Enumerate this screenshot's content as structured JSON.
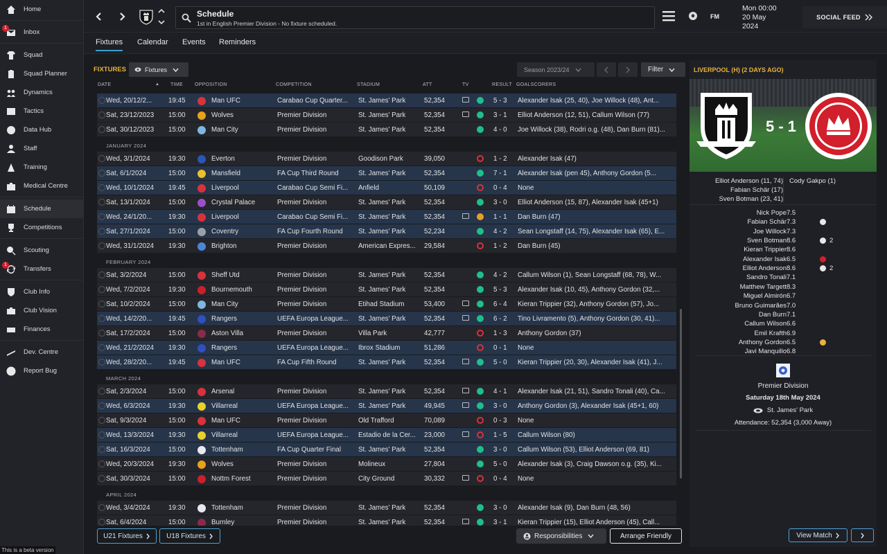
{
  "sidebar": {
    "items": [
      {
        "label": "Home",
        "icon": "home-icon"
      },
      {
        "label": "Inbox",
        "icon": "inbox-icon",
        "badge": "1"
      },
      {
        "label": "Squad",
        "icon": "shirt-icon"
      },
      {
        "label": "Squad Planner",
        "icon": "clipboard-icon"
      },
      {
        "label": "Dynamics",
        "icon": "dynamics-icon"
      },
      {
        "label": "Tactics",
        "icon": "tactics-board-icon"
      },
      {
        "label": "Data Hub",
        "icon": "data-hub-icon"
      },
      {
        "label": "Staff",
        "icon": "staff-icon"
      },
      {
        "label": "Training",
        "icon": "training-cone-icon"
      },
      {
        "label": "Medical Centre",
        "icon": "medical-kit-icon"
      },
      {
        "label": "Schedule",
        "icon": "calendar-icon"
      },
      {
        "label": "Competitions",
        "icon": "trophy-icon"
      },
      {
        "label": "Scouting",
        "icon": "magnifier-icon"
      },
      {
        "label": "Transfers",
        "icon": "transfers-icon",
        "badge": "1"
      },
      {
        "label": "Club Info",
        "icon": "shield-icon"
      },
      {
        "label": "Club Vision",
        "icon": "briefcase-icon"
      },
      {
        "label": "Finances",
        "icon": "cash-icon"
      },
      {
        "label": "Dev. Centre",
        "icon": "development-icon"
      },
      {
        "label": "Report Bug",
        "icon": "alert-icon"
      }
    ],
    "beta": "This is a beta version"
  },
  "header": {
    "title": "Schedule",
    "subtitle": "1st in English Premier Division - No fixture scheduled.",
    "fm": "FM",
    "date_line1": "Mon 00:00",
    "date_line2": "20 May",
    "date_line3": "2024",
    "social_feed": "SOCIAL FEED"
  },
  "tabs": [
    "Fixtures",
    "Calendar",
    "Events",
    "Reminders"
  ],
  "main": {
    "title": "FIXTURES",
    "view_dd": "Fixtures",
    "season": "Season 2023/24",
    "filter": "Filter",
    "columns": {
      "date": "DATE",
      "time": "TIME",
      "opposition": "OPPOSITION",
      "competition": "COMPETITION",
      "stadium": "STADIUM",
      "att": "ATT",
      "tv": "TV",
      "result": "RESULT",
      "goalscorers": "GOALSCORERS"
    },
    "footer": {
      "u21": "U21 Fixtures",
      "u18": "U18 Fixtures",
      "responsibilities": "Responsibilities",
      "arrange": "Arrange Friendly"
    }
  },
  "fixtures": [
    {
      "date": "Wed, 20/12/2...",
      "time": "19:45",
      "opp": "Man UFC",
      "comp": "Carabao Cup Quarter...",
      "stadium": "St. James' Park",
      "att": "52,354",
      "tv": true,
      "res": "W",
      "score": "5 - 3",
      "scorers": "Alexander Isak (25, 40), Joe Willock (48), Ant...",
      "hl": true,
      "crest": "#d8323c"
    },
    {
      "date": "Sat, 23/12/2023",
      "time": "15:00",
      "opp": "Wolves",
      "comp": "Premier Division",
      "stadium": "St. James' Park",
      "att": "52,354",
      "tv": true,
      "res": "W",
      "score": "3 - 1",
      "scorers": "Elliot Anderson (12, 51), Callum Wilson (77)",
      "crest": "#e8a11c"
    },
    {
      "date": "Sat, 30/12/2023",
      "time": "15:00",
      "opp": "Man City",
      "comp": "Premier Division",
      "stadium": "St. James' Park",
      "att": "52,354",
      "tv": false,
      "res": "W",
      "score": "4 - 0",
      "scorers": "Joe Willock (38), Rodri o.g. (48), Dan Burn (81)...",
      "crest": "#7fb6e0"
    },
    {
      "month": "JANUARY 2024"
    },
    {
      "date": "Wed, 3/1/2024",
      "time": "19:30",
      "opp": "Everton",
      "comp": "Premier Division",
      "stadium": "Goodison Park",
      "att": "39,050",
      "tv": false,
      "res": "L",
      "score": "1 - 2",
      "scorers": "Alexander Isak (47)",
      "crest": "#2a56b8"
    },
    {
      "date": "Sat, 6/1/2024",
      "time": "15:00",
      "opp": "Mansfield",
      "comp": "FA Cup Third Round",
      "stadium": "St. James' Park",
      "att": "52,354",
      "tv": false,
      "res": "W",
      "score": "7 - 1",
      "scorers": "Alexander Isak (pen 45), Anthony Gordon (5...",
      "hl": true,
      "crest": "#e8c12c"
    },
    {
      "date": "Wed, 10/1/2024",
      "time": "19:45",
      "opp": "Liverpool",
      "comp": "Carabao Cup Semi Fi...",
      "stadium": "Anfield",
      "att": "50,109",
      "tv": false,
      "res": "L",
      "score": "0 - 4",
      "scorers": "None",
      "hl": true,
      "crest": "#d8323c"
    },
    {
      "date": "Sat, 13/1/2024",
      "time": "15:00",
      "opp": "Crystal Palace",
      "comp": "Premier Division",
      "stadium": "St. James' Park",
      "att": "52,354",
      "tv": false,
      "res": "W",
      "score": "3 - 0",
      "scorers": "Elliot Anderson (15, 87), Alexander Isak (45+1)",
      "crest": "#9b4fc8"
    },
    {
      "date": "Wed, 24/1/20...",
      "time": "19:30",
      "opp": "Liverpool",
      "comp": "Carabao Cup Semi Fi...",
      "stadium": "St. James' Park",
      "att": "52,354",
      "tv": true,
      "res": "D",
      "score": "1 - 1",
      "scorers": "Dan Burn (47)",
      "hl": true,
      "crest": "#d8323c"
    },
    {
      "date": "Sat, 27/1/2024",
      "time": "15:00",
      "opp": "Coventry",
      "comp": "FA Cup Fourth Round",
      "stadium": "St. James' Park",
      "att": "52,234",
      "tv": false,
      "res": "W",
      "score": "4 - 2",
      "scorers": "Sean Longstaff (14, 75), Alexander Isak (65), E...",
      "hl": true,
      "crest": "#9aa0a8"
    },
    {
      "date": "Wed, 31/1/2024",
      "time": "19:30",
      "opp": "Brighton",
      "comp": "Premier Division",
      "stadium": "American Expres...",
      "att": "29,584",
      "tv": false,
      "res": "L",
      "score": "1 - 2",
      "scorers": "Dan Burn (45)",
      "crest": "#4b86d6"
    },
    {
      "month": "FEBRUARY 2024"
    },
    {
      "date": "Sat, 3/2/2024",
      "time": "15:00",
      "opp": "Sheff Utd",
      "comp": "Premier Division",
      "stadium": "St. James' Park",
      "att": "52,354",
      "tv": false,
      "res": "W",
      "score": "4 - 2",
      "scorers": "Callum Wilson (1), Sean Longstaff (68, 78), W...",
      "crest": "#d8323c"
    },
    {
      "date": "Wed, 7/2/2024",
      "time": "19:30",
      "opp": "Bournemouth",
      "comp": "Premier Division",
      "stadium": "St. James' Park",
      "att": "52,354",
      "tv": false,
      "res": "W",
      "score": "5 - 3",
      "scorers": "Alexander Isak (10, 45), Anthony Gordon (32,...",
      "crest": "#c8202c"
    },
    {
      "date": "Sat, 10/2/2024",
      "time": "15:00",
      "opp": "Man City",
      "comp": "Premier Division",
      "stadium": "Etihad Stadium",
      "att": "53,400",
      "tv": true,
      "res": "W",
      "score": "6 - 4",
      "scorers": "Kieran Trippier (32), Anthony Gordon (57), Jo...",
      "crest": "#7fb6e0"
    },
    {
      "date": "Wed, 14/2/20...",
      "time": "19:45",
      "opp": "Rangers",
      "comp": "UEFA Europa League...",
      "stadium": "St. James' Park",
      "att": "52,354",
      "tv": true,
      "res": "W",
      "score": "6 - 2",
      "scorers": "Tino Livramento (5), Anthony Gordon (30, 41)...",
      "hl": true,
      "crest": "#3050c0"
    },
    {
      "date": "Sat, 17/2/2024",
      "time": "15:00",
      "opp": "Aston Villa",
      "comp": "Premier Division",
      "stadium": "Villa Park",
      "att": "42,777",
      "tv": false,
      "res": "L",
      "score": "1 - 3",
      "scorers": "Anthony Gordon (37)",
      "crest": "#8a2a4a"
    },
    {
      "date": "Wed, 21/2/2024",
      "time": "19:30",
      "opp": "Rangers",
      "comp": "UEFA Europa League...",
      "stadium": "Ibrox Stadium",
      "att": "51,286",
      "tv": false,
      "res": "L",
      "score": "0 - 1",
      "scorers": "None",
      "hl": true,
      "crest": "#3050c0"
    },
    {
      "date": "Wed, 28/2/20...",
      "time": "19:45",
      "opp": "Man UFC",
      "comp": "FA Cup Fifth Round",
      "stadium": "St. James' Park",
      "att": "52,354",
      "tv": true,
      "res": "W",
      "score": "5 - 0",
      "scorers": "Kieran Trippier (20, 30), Alexander Isak (41), J...",
      "hl": true,
      "crest": "#d8323c"
    },
    {
      "month": "MARCH 2024"
    },
    {
      "date": "Sat, 2/3/2024",
      "time": "15:00",
      "opp": "Arsenal",
      "comp": "Premier Division",
      "stadium": "St. James' Park",
      "att": "52,354",
      "tv": true,
      "res": "W",
      "score": "4 - 1",
      "scorers": "Alexander Isak (21, 51), Sandro Tonali (40), Ca...",
      "crest": "#d8323c"
    },
    {
      "date": "Wed, 6/3/2024",
      "time": "19:30",
      "opp": "Villarreal",
      "comp": "UEFA Europa League...",
      "stadium": "St. James' Park",
      "att": "49,945",
      "tv": true,
      "res": "W",
      "score": "3 - 0",
      "scorers": "Anthony Gordon (3), Alexander Isak (45+1, 60)",
      "hl": true,
      "crest": "#e8d02c"
    },
    {
      "date": "Sat, 9/3/2024",
      "time": "15:00",
      "opp": "Man UFC",
      "comp": "Premier Division",
      "stadium": "Old Trafford",
      "att": "70,089",
      "tv": false,
      "res": "L",
      "score": "0 - 3",
      "scorers": "None",
      "crest": "#d8323c"
    },
    {
      "date": "Wed, 13/3/2024",
      "time": "19:30",
      "opp": "Villarreal",
      "comp": "UEFA Europa League...",
      "stadium": "Estadio de la Cer...",
      "att": "23,000",
      "tv": true,
      "res": "L",
      "score": "1 - 5",
      "scorers": "Callum Wilson (80)",
      "hl": true,
      "crest": "#e8d02c"
    },
    {
      "date": "Sat, 16/3/2024",
      "time": "15:00",
      "opp": "Tottenham",
      "comp": "FA Cup Quarter Final",
      "stadium": "St. James' Park",
      "att": "52,354",
      "tv": false,
      "res": "W",
      "score": "3 - 0",
      "scorers": "Callum Wilson (53), Elliot Anderson (69, 81)",
      "hl": true,
      "crest": "#e8e8f0"
    },
    {
      "date": "Wed, 20/3/2024",
      "time": "19:30",
      "opp": "Wolves",
      "comp": "Premier Division",
      "stadium": "Molineux",
      "att": "27,804",
      "tv": false,
      "res": "W",
      "score": "5 - 0",
      "scorers": "Alexander Isak (3), Craig Dawson o.g. (35), Ki...",
      "crest": "#e8a11c"
    },
    {
      "date": "Sat, 30/3/2024",
      "time": "15:00",
      "opp": "Nottm Forest",
      "comp": "Premier Division",
      "stadium": "City Ground",
      "att": "30,332",
      "tv": true,
      "res": "L",
      "score": "0 - 4",
      "scorers": "None",
      "crest": "#c8202c"
    },
    {
      "month": "APRIL 2024"
    },
    {
      "date": "Wed, 3/4/2024",
      "time": "19:30",
      "opp": "Tottenham",
      "comp": "Premier Division",
      "stadium": "St. James' Park",
      "att": "52,354",
      "tv": false,
      "res": "W",
      "score": "3 - 0",
      "scorers": "Alexander Isak (9), Dan Burn (48, 56)",
      "crest": "#e8e8f0"
    },
    {
      "date": "Sat, 6/4/2024",
      "time": "15:00",
      "opp": "Burnley",
      "comp": "Premier Division",
      "stadium": "St. James' Park",
      "att": "52,354",
      "tv": true,
      "res": "W",
      "score": "3 - 1",
      "scorers": "Kieran Trippier (15), Elliot Anderson (45), Call...",
      "crest": "#8a2a4a"
    }
  ],
  "right": {
    "title": "LIVERPOOL (H) (2 DAYS AGO)",
    "score": "5 - 1",
    "home_scorers": [
      "Elliot Anderson (11, 74)",
      "Fabian Schär (17)",
      "Sven Botman (23, 41)"
    ],
    "away_scorers": [
      "Cody Gakpo (1)"
    ],
    "players": [
      {
        "name": "Nick Pope",
        "rating": "7.5"
      },
      {
        "name": "Fabian Schär",
        "rating": "7.3",
        "ev": "goal"
      },
      {
        "name": "Joe Willock",
        "rating": "7.3"
      },
      {
        "name": "Sven Botman",
        "rating": "8.6",
        "ev": "goal",
        "count": "2"
      },
      {
        "name": "Kieran Trippier",
        "rating": "8.6"
      },
      {
        "name": "Alexander Isak",
        "rating": "6.5",
        "ev": "injury"
      },
      {
        "name": "Elliot Anderson",
        "rating": "8.6",
        "ev": "goal",
        "count": "2"
      },
      {
        "name": "Sandro Tonali",
        "rating": "7.1"
      },
      {
        "name": "Matthew Targett",
        "rating": "8.3"
      },
      {
        "name": "Miguel Almirón",
        "rating": "6.7"
      },
      {
        "name": "Bruno Guimarães",
        "rating": "7.0"
      },
      {
        "name": "Dan Burn",
        "rating": "7.1"
      },
      {
        "name": "Callum Wilson",
        "rating": "6.6"
      },
      {
        "name": "Emil Krafth",
        "rating": "6.9"
      },
      {
        "name": "Anthony Gordon",
        "rating": "6.5",
        "ev": "card"
      },
      {
        "name": "Javi Manquillo",
        "rating": "6.8"
      }
    ],
    "competition": "Premier Division",
    "match_date": "Saturday 18th May 2024",
    "stadium": "St. James' Park",
    "attendance": "Attendance: 52,354 (3,000 Away)",
    "view_match": "View Match"
  },
  "colors": {
    "accent": "#e8b23a",
    "win": "#1fbf8a",
    "loss": "#d8323c",
    "draw": "#e3a12c",
    "link": "#4da2d8"
  }
}
